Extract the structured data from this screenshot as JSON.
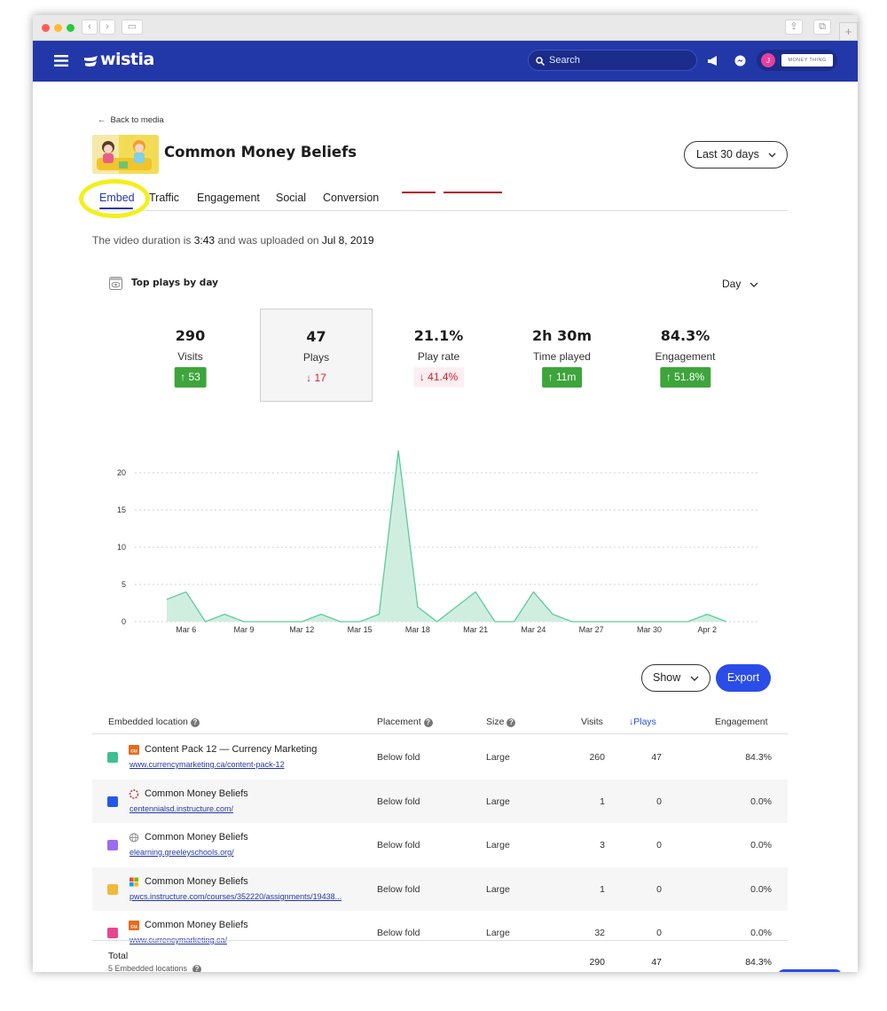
{
  "brand": {
    "logo_text": "wistia",
    "accent": "#2338a8",
    "nav_bg": "#2338a8",
    "button_blue": "#2a4de8",
    "up_green": "#3da53b",
    "down_red": "#d0212f"
  },
  "nav": {
    "search_placeholder": "Search",
    "avatar_initial": "J",
    "account_name": "MONEY THING"
  },
  "page": {
    "back_link": "Back to media",
    "title": "Common Money Beliefs",
    "date_range": "Last 30 days",
    "tabs": [
      "Embed",
      "Traffic",
      "Engagement",
      "Social",
      "Conversion"
    ],
    "active_tab": "Embed",
    "desc_prefix": "The video duration is",
    "duration": "3:43",
    "desc_mid": "and was uploaded on",
    "upload_date": "Jul 8, 2019"
  },
  "card": {
    "title": "Top plays by day",
    "granularity": "Day",
    "metrics": [
      {
        "value": "290",
        "label": "Visits",
        "change": "53",
        "direction": "up",
        "selected": false
      },
      {
        "value": "47",
        "label": "Plays",
        "change": "17",
        "direction": "down",
        "selected": true
      },
      {
        "value": "21.1%",
        "label": "Play rate",
        "change": "41.4%",
        "direction": "down",
        "selected": false
      },
      {
        "value": "2h 30m",
        "label": "Time played",
        "change": "11m",
        "direction": "up",
        "selected": false
      },
      {
        "value": "84.3%",
        "label": "Engagement",
        "change": "51.8%",
        "direction": "up",
        "selected": false
      }
    ]
  },
  "chart_data": {
    "type": "area",
    "x": [
      "Mar 5",
      "Mar 6",
      "Mar 7",
      "Mar 8",
      "Mar 9",
      "Mar 10",
      "Mar 11",
      "Mar 12",
      "Mar 13",
      "Mar 14",
      "Mar 15",
      "Mar 16",
      "Mar 17",
      "Mar 18",
      "Mar 19",
      "Mar 20",
      "Mar 21",
      "Mar 22",
      "Mar 23",
      "Mar 24",
      "Mar 25",
      "Mar 26",
      "Mar 27",
      "Mar 28",
      "Mar 29",
      "Mar 30",
      "Mar 31",
      "Apr 1",
      "Apr 2",
      "Apr 3"
    ],
    "x_tick_labels": [
      "Mar 6",
      "Mar 9",
      "Mar 12",
      "Mar 15",
      "Mar 18",
      "Mar 21",
      "Mar 24",
      "Mar 27",
      "Mar 30",
      "Apr 2"
    ],
    "series": [
      {
        "values": [
          3,
          4,
          0,
          1,
          0,
          0,
          0,
          0,
          1,
          0,
          0,
          1,
          23,
          2,
          0,
          2,
          4,
          0,
          0,
          4,
          1,
          0,
          0,
          0,
          0,
          0,
          0,
          0,
          1,
          0
        ]
      }
    ],
    "ylim": [
      0,
      23
    ],
    "y_ticks": [
      0,
      5,
      10,
      15,
      20
    ],
    "grid": true,
    "fill_color": "#cfeee0",
    "line_color": "#5fcb9d"
  },
  "table": {
    "show_label": "Show",
    "export_label": "Export",
    "headers": {
      "location": "Embedded location",
      "placement": "Placement",
      "size": "Size",
      "visits": "Visits",
      "plays": "Plays",
      "engagement": "Engagement"
    },
    "rows": [
      {
        "color": "#3dbf8f",
        "icon": "cu-logo-icon",
        "name": "Content Pack 12 — Currency Marketing",
        "url": "www.currencymarketing.ca/content-pack-12",
        "placement": "Below fold",
        "size": "Large",
        "visits": "260",
        "plays": "47",
        "engagement": "84.3%"
      },
      {
        "color": "#2557e8",
        "icon": "red-dashed-circle-icon",
        "name": "Common Money Beliefs",
        "url": "centennialsd.instructure.com/",
        "placement": "Below fold",
        "size": "Large",
        "visits": "1",
        "plays": "0",
        "engagement": "0.0%"
      },
      {
        "color": "#9b6cf0",
        "icon": "globe-icon",
        "name": "Common Money Beliefs",
        "url": "elearning.greeleyschools.org/",
        "placement": "Below fold",
        "size": "Large",
        "visits": "3",
        "plays": "0",
        "engagement": "0.0%"
      },
      {
        "color": "#f2b83a",
        "icon": "windows-logo-icon",
        "name": "Common Money Beliefs",
        "url": "pwcs.instructure.com/courses/352220/assignments/19438...",
        "placement": "Below fold",
        "size": "Large",
        "visits": "1",
        "plays": "0",
        "engagement": "0.0%"
      },
      {
        "color": "#e8468f",
        "icon": "cu-logo-icon",
        "name": "Common Money Beliefs",
        "url": "www.currencymarketing.ca/",
        "placement": "Below fold",
        "size": "Large",
        "visits": "32",
        "plays": "0",
        "engagement": "0.0%"
      }
    ],
    "total": {
      "label": "Total",
      "sub": "5 Embedded locations",
      "visits": "290",
      "plays": "47",
      "engagement": "84.3%"
    }
  }
}
